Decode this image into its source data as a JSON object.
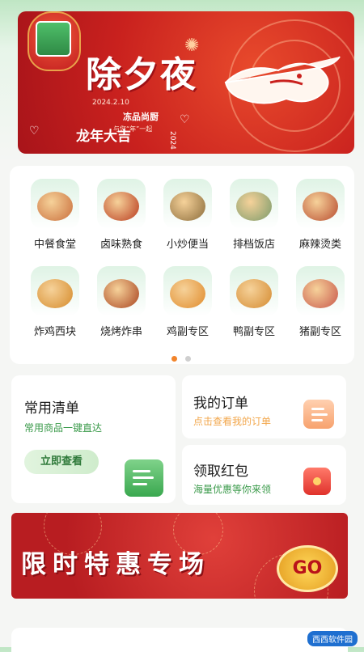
{
  "banner": {
    "title": "除夕夜",
    "date": "2024.2.10",
    "brand": "冻品尚厨",
    "slogan": "与您“年”一起",
    "luck": "龙年大吉",
    "year": "2024"
  },
  "categories": [
    {
      "label": "中餐食堂",
      "icon": "chinese-meal-icon",
      "color": "#c96d3a"
    },
    {
      "label": "卤味熟食",
      "icon": "braised-food-icon",
      "color": "#b8391d"
    },
    {
      "label": "小炒便当",
      "icon": "stir-fry-bento-icon",
      "color": "#8a6b3a"
    },
    {
      "label": "排档饭店",
      "icon": "restaurant-icon",
      "color": "#7a9a6a"
    },
    {
      "label": "麻辣烫类",
      "icon": "spicy-hotpot-icon",
      "color": "#b74a2e"
    },
    {
      "label": "炸鸡西块",
      "icon": "burger-icon",
      "color": "#d58a2a"
    },
    {
      "label": "烧烤炸串",
      "icon": "bbq-skewer-icon",
      "color": "#a8421e"
    },
    {
      "label": "鸡副专区",
      "icon": "chicken-icon",
      "color": "#e08a2a"
    },
    {
      "label": "鸭副专区",
      "icon": "duck-icon",
      "color": "#d48a30"
    },
    {
      "label": "猪副专区",
      "icon": "pork-icon",
      "color": "#c8564a"
    }
  ],
  "pager": {
    "active": 0,
    "total": 2,
    "active_color": "#f2842b",
    "inactive_color": "#cfcfcf"
  },
  "cards": {
    "common": {
      "title": "常用清单",
      "subtitle": "常用商品一键直达",
      "button": "立即查看"
    },
    "orders": {
      "title": "我的订单",
      "subtitle": "点击查看我的订单"
    },
    "coupons": {
      "title": "领取红包",
      "subtitle": "海量优惠等你来领"
    }
  },
  "promo": {
    "text": "限时特惠专场",
    "go": "GO"
  },
  "colors": {
    "accent_green": "#2f9b45",
    "accent_orange": "#f2a64a",
    "red": "#c9211e"
  },
  "watermark": "西西软件园"
}
